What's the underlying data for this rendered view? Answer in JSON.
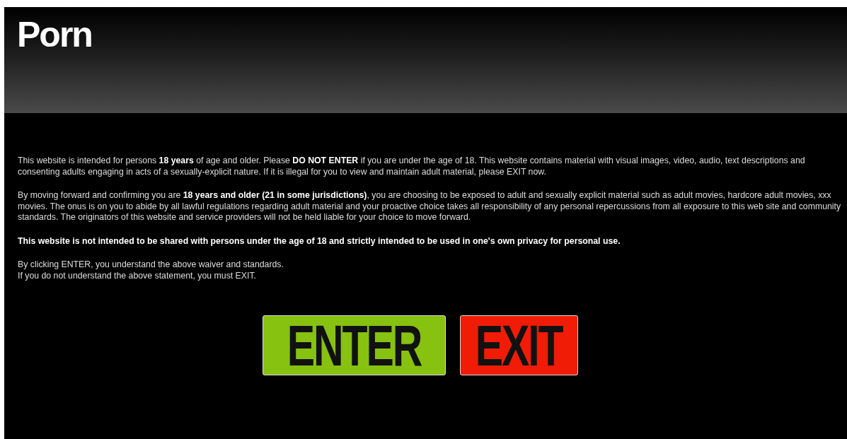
{
  "header": {
    "logo": "Porn"
  },
  "paragraphs": [
    {
      "text": "This website is intended for persons **18 years** of age and older. Please **DO NOT ENTER** if you are under the age of 18. This website contains material with visual images, video, audio, text descriptions and consenting adults engaging in acts of a sexually-explicit nature. If it is illegal for you to view and maintain adult material, please EXIT now.",
      "bold": false
    },
    {
      "text": "By moving forward and confirming you are **18 years and older (21 in some jurisdictions)**, you are choosing to be exposed to adult and sexually explicit material such as adult movies, hardcore adult movies, xxx movies. The onus is on you to abide by all lawful regulations regarding adult material and your proactive choice takes all responsibility of any personal repercussions from all exposure to this web site and community standards. The originators of this website and service providers will not be held liable for your choice to move forward.",
      "bold": false
    },
    {
      "text": "This website is not intended to be shared with persons under the age of 18 and strictly intended to be used in one's own privacy for personal use.",
      "bold": true
    }
  ],
  "notice_lines": [
    "By clicking ENTER, you understand the above waiver and standards.",
    "If you do not understand the above statement, you must EXIT."
  ],
  "buttons": [
    {
      "label": "ENTER",
      "kind": "enter"
    },
    {
      "label": "EXIT",
      "kind": "exit"
    }
  ]
}
